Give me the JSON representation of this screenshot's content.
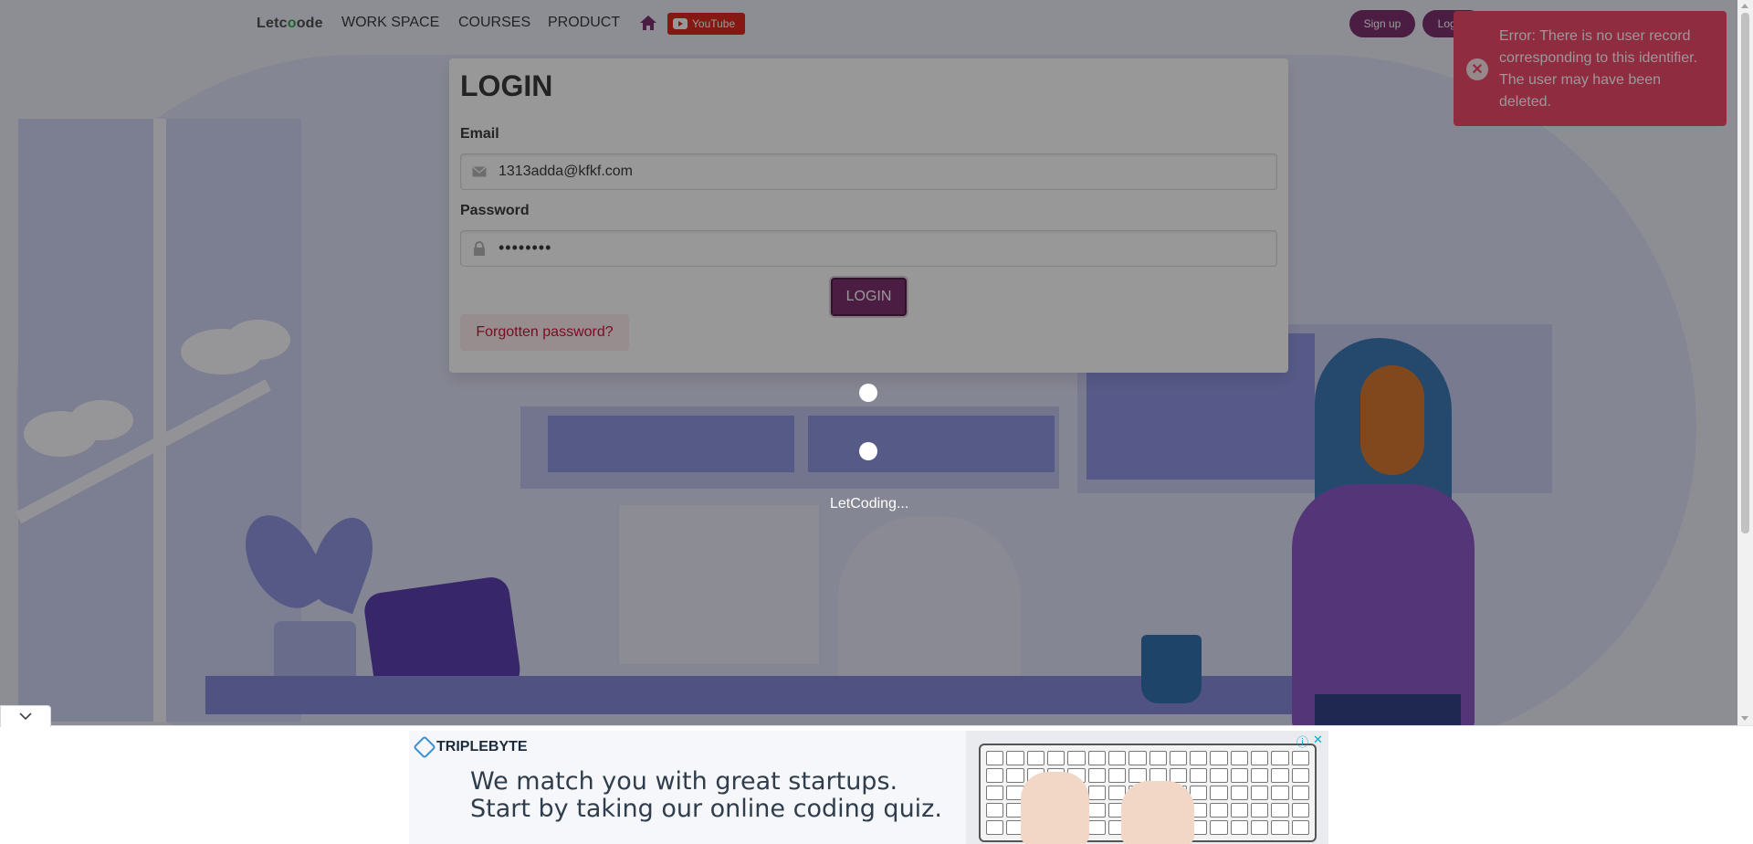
{
  "navbar": {
    "logo_pre": "Let",
    "logo_o": "o",
    "logo_post": "ode",
    "logo_c": "c",
    "items": [
      "WORK SPACE",
      "COURSES",
      "PRODUCT"
    ],
    "youtube_label": "YouTube",
    "signup_label": "Sign up",
    "login_label": "Log in"
  },
  "login_card": {
    "title": "LOGIN",
    "email_label": "Email",
    "email_value": "1313adda@kfkf.com",
    "password_label": "Password",
    "password_value": "••••••••",
    "login_button": "LOGIN",
    "forgot_button": "Forgotten password?"
  },
  "loader": {
    "text": "LetCoding..."
  },
  "toast": {
    "message": "Error: There is no user record corresponding to this identifier. The user may have been deleted.",
    "color": "#f14668"
  },
  "ad": {
    "brand": "TRIPLEBYTE",
    "line1": "We match you with great startups.",
    "line2": "Start by taking our online coding quiz."
  },
  "colors": {
    "primary": "#7a2c6b",
    "danger": "#f14668",
    "youtube": "#e0241b"
  }
}
